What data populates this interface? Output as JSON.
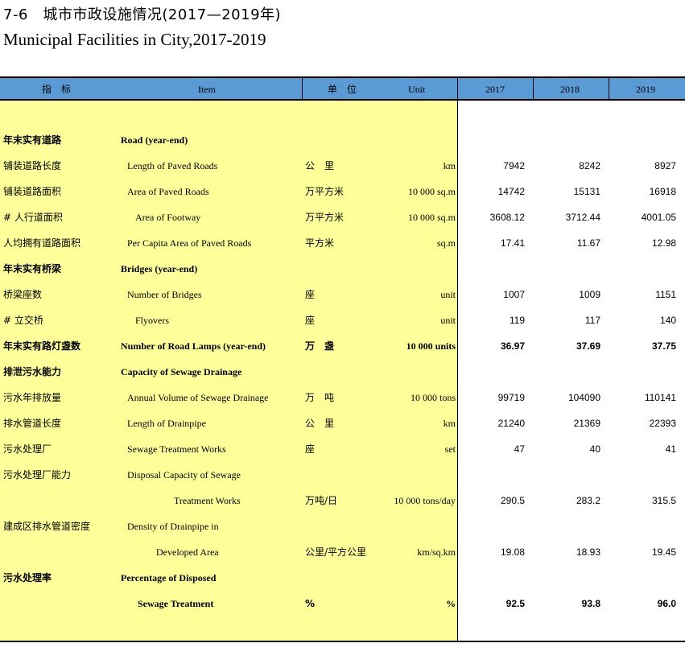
{
  "title_zh": "7-6　城市市政设施情况(2017—2019年)",
  "title_en": "Municipal Facilities in City,2017-2019",
  "header": {
    "indicator": "指　标",
    "item": "Item",
    "unit_zh": "单　位",
    "unit": "Unit",
    "y2017": "2017",
    "y2018": "2018",
    "y2019": "2019"
  },
  "rows": [
    {
      "zh": "年末实有道路",
      "en": "Road (year-end)",
      "uzh": "",
      "uen": "",
      "v17": "",
      "v18": "",
      "v19": ""
    },
    {
      "zh": "  铺装道路长度",
      "en": "Length of Paved Roads",
      "uzh": "公　里",
      "uen": "km",
      "v17": "7942",
      "v18": "8242",
      "v19": "8927"
    },
    {
      "zh": "  铺装道路面积",
      "en": "Area of Paved Roads",
      "uzh": "万平方米",
      "uen": "10 000 sq.m",
      "v17": "14742",
      "v18": "15131",
      "v19": "16918"
    },
    {
      "zh": "  # 人行道面积",
      "en": "Area of Footway",
      "uzh": "万平方米",
      "uen": "10 000 sq.m",
      "v17": "3608.12",
      "v18": "3712.44",
      "v19": "4001.05"
    },
    {
      "zh": "  人均拥有道路面积",
      "en": "Per Capita Area of Paved Roads",
      "uzh": "平方米",
      "uen": "sq.m",
      "v17": "17.41",
      "v18": "11.67",
      "v19": "12.98"
    },
    {
      "zh": "年末实有桥梁",
      "en": "Bridges (year-end)",
      "uzh": "",
      "uen": "",
      "v17": "",
      "v18": "",
      "v19": ""
    },
    {
      "zh": "  桥梁座数",
      "en": "Number of Bridges",
      "uzh": "座",
      "uen": "unit",
      "v17": "1007",
      "v18": "1009",
      "v19": "1151"
    },
    {
      "zh": "  # 立交桥",
      "en": "Flyovers",
      "uzh": "座",
      "uen": "unit",
      "v17": "119",
      "v18": "117",
      "v19": "140"
    },
    {
      "zh": "年末实有路灯盏数",
      "en": "Number of Road Lamps (year-end)",
      "uzh": "万　盏",
      "uen": "10 000 units",
      "v17": "36.97",
      "v18": "37.69",
      "v19": "37.75"
    },
    {
      "zh": "排泄污水能力",
      "en": "Capacity of Sewage Drainage",
      "uzh": "",
      "uen": "",
      "v17": "",
      "v18": "",
      "v19": ""
    },
    {
      "zh": "  污水年排放量",
      "en": "Annual Volume of Sewage Drainage",
      "uzh": "万　吨",
      "uen": "10 000 tons",
      "v17": "99719",
      "v18": "104090",
      "v19": "110141"
    },
    {
      "zh": "  排水管道长度",
      "en": "Length of Drainpipe",
      "uzh": "公　里",
      "uen": "km",
      "v17": "21240",
      "v18": "21369",
      "v19": "22393"
    },
    {
      "zh": "  污水处理厂",
      "en": "Sewage Treatment Works",
      "uzh": "座",
      "uen": "set",
      "v17": "47",
      "v18": "40",
      "v19": "41"
    },
    {
      "zh": "  污水处理厂能力",
      "en": "Disposal Capacity of Sewage",
      "uzh": "",
      "uen": "",
      "v17": "",
      "v18": "",
      "v19": ""
    },
    {
      "zh": "",
      "en": "Treatment Works",
      "uzh": "万吨/日",
      "uen": "10 000 tons/day",
      "v17": "290.5",
      "v18": "283.2",
      "v19": "315.5"
    },
    {
      "zh": "  建成区排水管道密度",
      "en": "Density of Drainpipe in",
      "uzh": "",
      "uen": "",
      "v17": "",
      "v18": "",
      "v19": ""
    },
    {
      "zh": "",
      "en": "Developed Area",
      "uzh": "公里/平方公里",
      "uen": "km/sq.km",
      "v17": "19.08",
      "v18": "18.93",
      "v19": "19.45"
    },
    {
      "zh": "污水处理率",
      "en": "Percentage of Disposed",
      "uzh": "",
      "uen": "",
      "v17": "",
      "v18": "",
      "v19": ""
    },
    {
      "zh": "",
      "en": "Sewage Treatment",
      "uzh": "%",
      "uen": "%",
      "v17": "92.5",
      "v18": "93.8",
      "v19": "96.0"
    }
  ]
}
